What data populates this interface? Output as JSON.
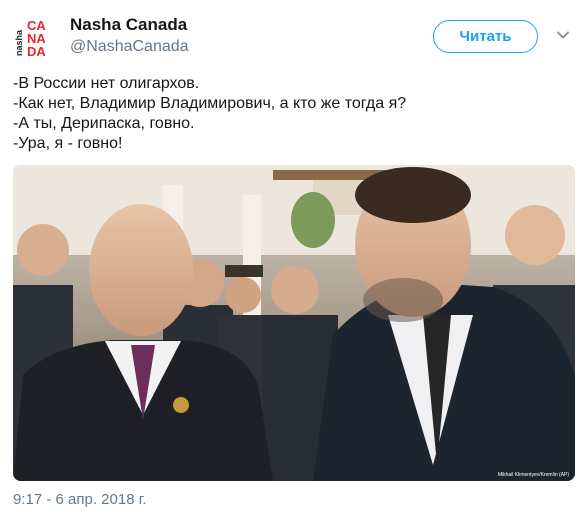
{
  "author": {
    "name": "Nasha Canada",
    "handle": "@NashaCanada",
    "logo_text_small": "nasha",
    "logo_text_top": "CA",
    "logo_text_mid": "NA",
    "logo_text_bottom": "DA"
  },
  "follow_label": "Читать",
  "tweet_lines": [
    "-В России нет олигархов.",
    "-Как нет, Владимир Владимирович, а кто же тогда я?",
    "-А ты, Дерипаска, говно.",
    "-Ура, я - говно!"
  ],
  "photo": {
    "credit": "Mikhail Klimentyev/Kremlin (AP)"
  },
  "timestamp": "9:17 - 6 апр. 2018 г.",
  "colors": {
    "accent": "#1da1f2",
    "logo_red": "#e8242c",
    "muted": "#657786"
  },
  "icons": {
    "menu": "chevron-down-icon"
  }
}
